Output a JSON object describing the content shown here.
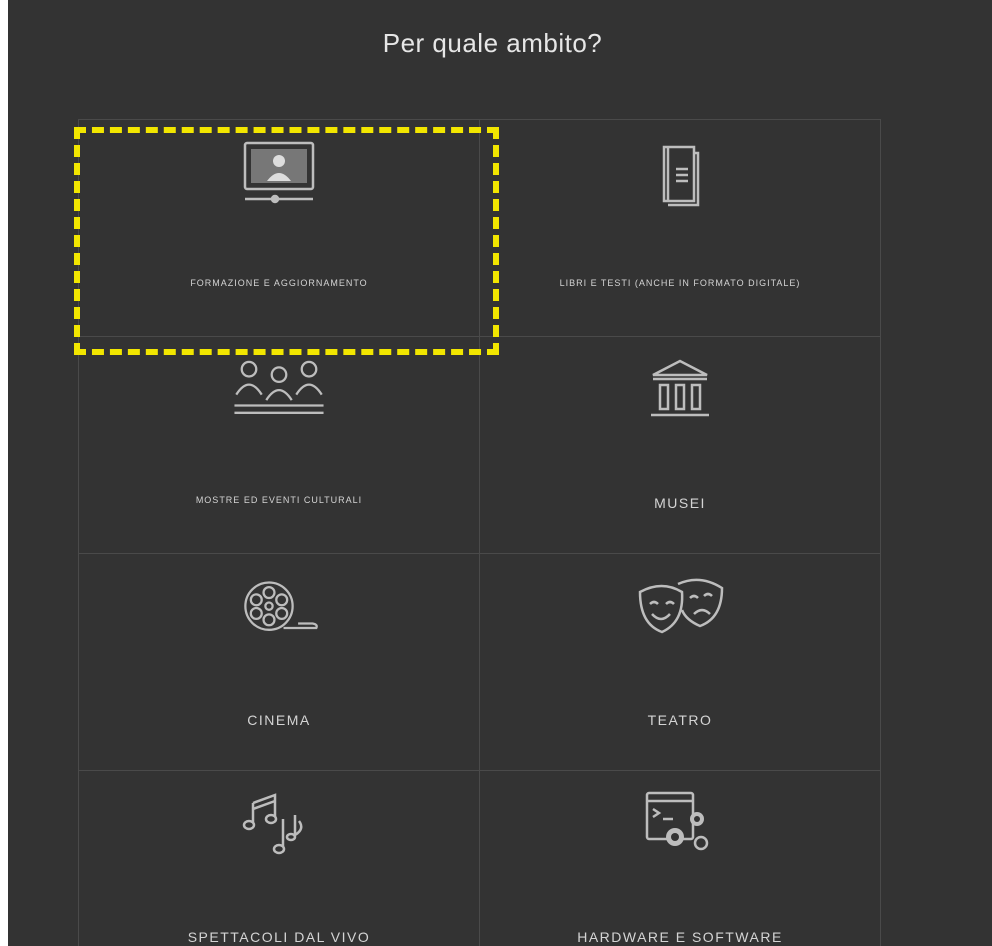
{
  "header": {
    "title": "Per quale ambito?"
  },
  "categories": [
    {
      "label": "FORMAZIONE E AGGIORNAMENTO",
      "icon": "video-lesson-icon"
    },
    {
      "label": "LIBRI E TESTI (ANCHE IN FORMATO DIGITALE)",
      "icon": "book-icon"
    },
    {
      "label": "MOSTRE ED EVENTI CULTURALI",
      "icon": "audience-icon"
    },
    {
      "label": "MUSEI",
      "icon": "museum-icon"
    },
    {
      "label": "CINEMA",
      "icon": "film-reel-icon"
    },
    {
      "label": "TEATRO",
      "icon": "theater-masks-icon"
    },
    {
      "label": "SPETTACOLI DAL VIVO",
      "icon": "music-notes-icon"
    },
    {
      "label": "HARDWARE E SOFTWARE",
      "icon": "software-gears-icon"
    }
  ],
  "colors": {
    "background": "#333333",
    "grid": "#4a4a4a",
    "text": "#d4d4d4",
    "highlight": "#f2e600"
  }
}
